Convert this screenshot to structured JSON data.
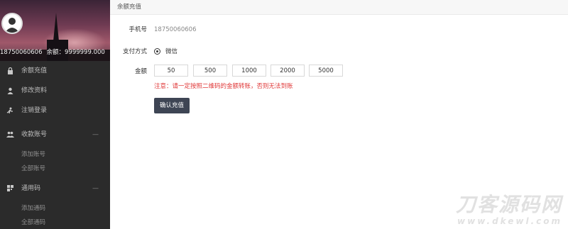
{
  "sidebar": {
    "phone": "18750060606",
    "balance_label": "余额：",
    "balance_value": "9999999.000",
    "items": [
      {
        "label": "余额充值",
        "icon": "lock-icon"
      },
      {
        "label": "修改资料",
        "icon": "user-icon"
      },
      {
        "label": "注销登录",
        "icon": "logout-icon"
      },
      {
        "label": "收款账号",
        "icon": "users-icon",
        "arrow": "—"
      },
      {
        "label": "添加账号"
      },
      {
        "label": "全部账号"
      },
      {
        "label": "通用码",
        "icon": "qrcode-icon",
        "arrow": "—"
      },
      {
        "label": "添加通码"
      },
      {
        "label": "全部通码"
      }
    ]
  },
  "header": {
    "title": "余额充值"
  },
  "form": {
    "phone_label": "手机号",
    "phone_value": "18750060606",
    "payment_label": "支付方式",
    "payment_option": "微信",
    "amount_label": "金额",
    "amounts": [
      "50",
      "500",
      "1000",
      "2000",
      "5000"
    ],
    "warning": "注意：请一定按照二维码的金额转账，否则无法到账",
    "confirm_label": "确认充值"
  },
  "watermark": {
    "line1": "刀客源码网",
    "line2": "www.dkewl.com"
  },
  "colors": {
    "warning": "#e03a3a",
    "button": "#3e4554",
    "sidebar": "#2b2b2b"
  }
}
